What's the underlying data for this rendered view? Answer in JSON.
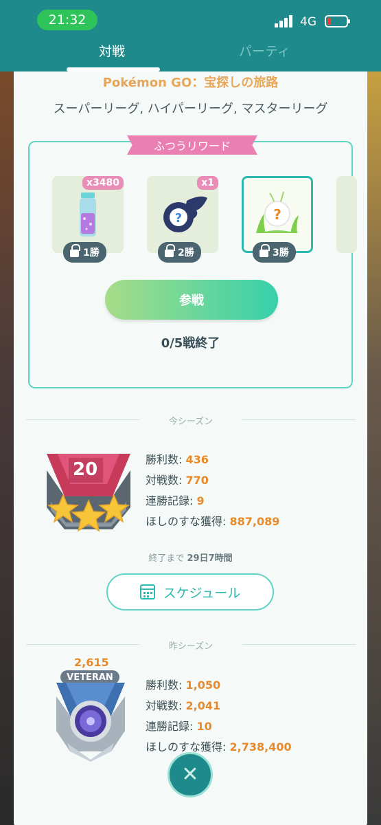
{
  "status_bar": {
    "time": "21:32",
    "network": "4G",
    "battery_level": 0.15
  },
  "tabs": [
    {
      "label": "対戦",
      "active": true
    },
    {
      "label": "パーティ",
      "active": false
    }
  ],
  "league": {
    "title": "Pokémon GO：宝探しの旅路",
    "subtitle": "スーパーリーグ, ハイパーリーグ, マスターリーグ"
  },
  "rewards": {
    "header": "ふつうリワード",
    "items": [
      {
        "icon": "stardust-icon",
        "count": "x3480",
        "requirement": "1勝"
      },
      {
        "icon": "mystery-ball-icon",
        "count": "x1",
        "requirement": "2勝"
      },
      {
        "icon": "mystery-encounter-icon",
        "count": "",
        "requirement": "3勝"
      }
    ],
    "join_label": "参戦",
    "progress": "0/5戦終了"
  },
  "current_season": {
    "divider": "今シーズン",
    "rank": "20",
    "stats": [
      {
        "label": "勝利数:",
        "value": "436"
      },
      {
        "label": "対戦数:",
        "value": "770"
      },
      {
        "label": "連勝記録:",
        "value": "9"
      },
      {
        "label": "ほしのすな獲得:",
        "value": "887,089"
      }
    ],
    "ends_prefix": "終了まで",
    "ends_value": "29日7時間",
    "schedule_label": "スケジュール"
  },
  "previous_season": {
    "divider": "昨シーズン",
    "rating": "2,615",
    "tier": "VETERAN",
    "stats": [
      {
        "label": "勝利数:",
        "value": "1,050"
      },
      {
        "label": "対戦数:",
        "value": "2,041"
      },
      {
        "label": "連勝記録:",
        "value": "10"
      },
      {
        "label": "ほしのすな獲得:",
        "value": "2,738,400"
      }
    ]
  },
  "colors": {
    "teal": "#1e8a8c",
    "accent_orange": "#e88a2a",
    "pink": "#ea80b2",
    "mint": "#5fd4c4"
  }
}
